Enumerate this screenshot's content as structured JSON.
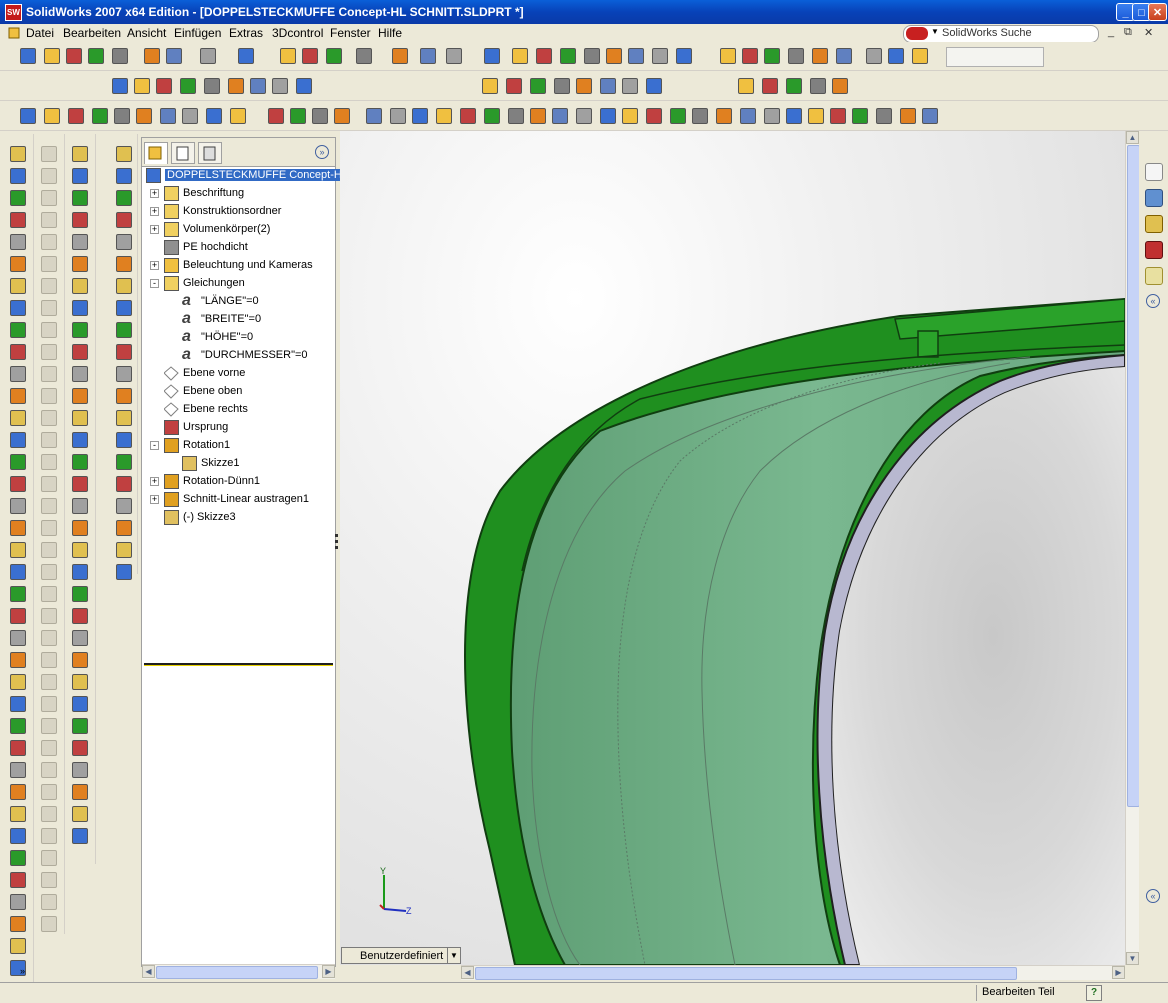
{
  "window": {
    "title": "SolidWorks 2007 x64 Edition - [DOPPELSTECKMUFFE Concept-HL SCHNITT.SLDPRT *]",
    "app_badge": "SW"
  },
  "menu": {
    "items": [
      "Datei",
      "Bearbeiten",
      "Ansicht",
      "Einfügen",
      "Extras",
      "3Dcontrol",
      "Fenster",
      "Hilfe"
    ]
  },
  "search": {
    "value": "SolidWorks Suche"
  },
  "feature_tree": {
    "nodes": [
      {
        "label": "DOPPELSTECKMUFFE Concept-HL S",
        "icon": "part-icon",
        "color": "#3a6fd0"
      },
      {
        "label": "Beschriftung",
        "icon": "annotation-icon",
        "color": "#f0d060"
      },
      {
        "label": "Konstruktionsordner",
        "icon": "design-binder-icon",
        "color": "#f0d060"
      },
      {
        "label": "Volumenkörper(2)",
        "icon": "solid-bodies-icon",
        "color": "#f0d060"
      },
      {
        "label": "PE hochdicht",
        "icon": "material-icon",
        "color": "#909090"
      },
      {
        "label": "Beleuchtung und Kameras",
        "icon": "lights-icon",
        "color": "#f0c040"
      },
      {
        "label": "Gleichungen",
        "icon": "equations-icon",
        "color": "#f0d060"
      },
      {
        "label": "\"LÄNGE\"=0",
        "icon": "equation-icon",
        "color": "#404040"
      },
      {
        "label": "\"BREITE\"=0",
        "icon": "equation-icon",
        "color": "#404040"
      },
      {
        "label": "\"HÖHE\"=0",
        "icon": "equation-icon",
        "color": "#404040"
      },
      {
        "label": "\"DURCHMESSER\"=0",
        "icon": "equation-icon",
        "color": "#404040"
      },
      {
        "label": "Ebene vorne",
        "icon": "plane-icon",
        "color": "#808080"
      },
      {
        "label": "Ebene oben",
        "icon": "plane-icon",
        "color": "#808080"
      },
      {
        "label": "Ebene rechts",
        "icon": "plane-icon",
        "color": "#808080"
      },
      {
        "label": "Ursprung",
        "icon": "origin-icon",
        "color": "#c04040"
      },
      {
        "label": "Rotation1",
        "icon": "revolve-icon",
        "color": "#e0a020"
      },
      {
        "label": "Skizze1",
        "icon": "sketch-icon",
        "color": "#e0c060"
      },
      {
        "label": "Rotation-Dünn1",
        "icon": "revolve-thin-icon",
        "color": "#e0a020"
      },
      {
        "label": "Schnitt-Linear austragen1",
        "icon": "cut-extrude-icon",
        "color": "#e0a020"
      },
      {
        "label": "(-) Skizze3",
        "icon": "sketch-icon",
        "color": "#e0c060"
      }
    ]
  },
  "view": {
    "orientation_label": "Benutzerdefiniert",
    "triad": {
      "y": "Y",
      "z": "Z"
    }
  },
  "status": {
    "mode": "Bearbeiten Teil",
    "help": "?"
  },
  "colors": {
    "model_green": "#1f8f1f",
    "inner_green": "#6db085",
    "selection": "#316ac5",
    "title_blue": "#0a5fd8"
  }
}
